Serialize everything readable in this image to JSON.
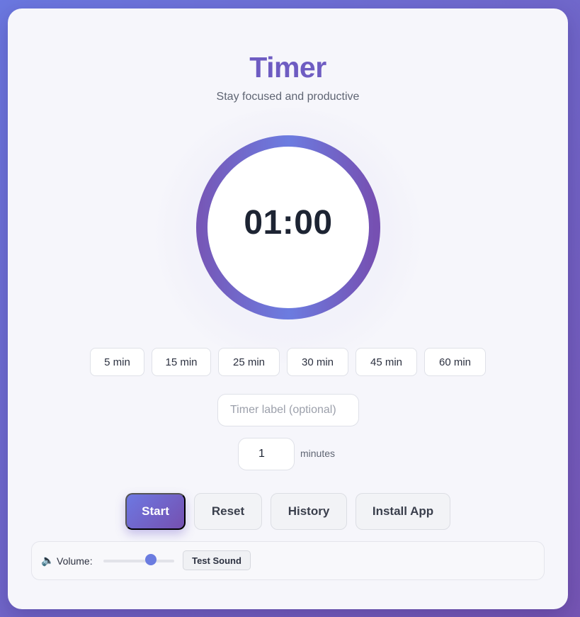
{
  "app": {
    "title": "Timer",
    "subtitle": "Stay focused and productive"
  },
  "timer": {
    "display": "01:00",
    "progress": 1.0,
    "accent_start": "#6d7ce0",
    "accent_end": "#7650b2"
  },
  "presets": [
    {
      "label": "5 min"
    },
    {
      "label": "15 min"
    },
    {
      "label": "25 min"
    },
    {
      "label": "30 min"
    },
    {
      "label": "45 min"
    },
    {
      "label": "60 min"
    }
  ],
  "label_input": {
    "placeholder": "Timer label (optional)",
    "value": ""
  },
  "minutes_input": {
    "value": "1",
    "unit_label": "minutes"
  },
  "controls": {
    "start_label": "Start",
    "reset_label": "Reset",
    "history_label": "History",
    "install_label": "Install App"
  },
  "volume": {
    "icon": "speaker-icon",
    "icon_glyph": "🔈",
    "label": "Volume:",
    "level": 0.67,
    "test_sound_label": "Test Sound"
  },
  "colors": {
    "title": "#6e5cc2",
    "primary_gradient_start": "#6d78e2",
    "primary_gradient_end": "#7550b0",
    "background_start": "#6b78e0",
    "background_end": "#7656b4"
  }
}
